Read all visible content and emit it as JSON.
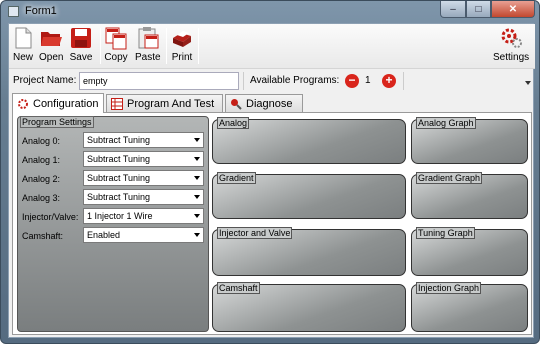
{
  "window": {
    "title": "Form1",
    "minimize_glyph": "‒",
    "maximize_glyph": "□",
    "close_glyph": "✕"
  },
  "toolbar": {
    "new_label": "New",
    "open_label": "Open",
    "save_label": "Save",
    "copy_label": "Copy",
    "paste_label": "Paste",
    "print_label": "Print",
    "settings_label": "Settings"
  },
  "project": {
    "name_label": "Project Name:",
    "name_value": "empty",
    "available_label": "Available Programs:",
    "available_count": "1",
    "minus_glyph": "−",
    "plus_glyph": "+"
  },
  "tabs": {
    "configuration": "Configuration",
    "program_test": "Program And Test",
    "diagnose": "Diagnose"
  },
  "program_settings": {
    "header": "Program Settings",
    "rows": [
      {
        "label": "Analog 0:",
        "value": "Subtract Tuning"
      },
      {
        "label": "Analog 1:",
        "value": "Subtract Tuning"
      },
      {
        "label": "Analog 2:",
        "value": "Subtract Tuning"
      },
      {
        "label": "Analog 3:",
        "value": "Subtract Tuning"
      },
      {
        "label": "Injector/Valve:",
        "value": "1 Injector 1 Wire"
      },
      {
        "label": "Camshaft:",
        "value": "Enabled"
      }
    ]
  },
  "groups": {
    "analog": "Analog",
    "analog_graph": "Analog Graph",
    "gradient": "Gradient",
    "gradient_graph": "Gradient Graph",
    "injector_valve": "Injector and Valve",
    "tuning_graph": "Tuning Graph",
    "camshaft": "Camshaft",
    "injection_graph": "Injection Graph"
  },
  "colors": {
    "accent_red": "#d9251c",
    "panel_dark": "#7a7e7f"
  }
}
